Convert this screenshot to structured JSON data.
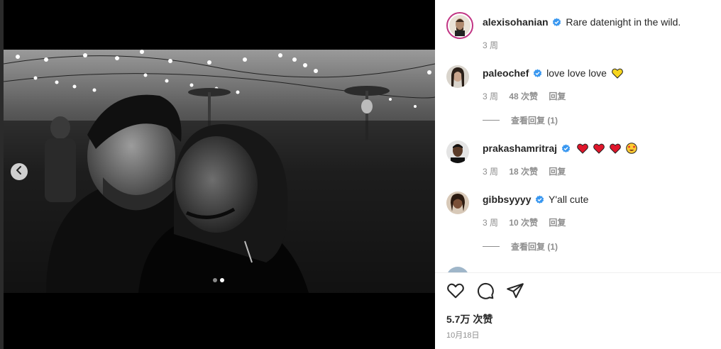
{
  "post": {
    "author": "alexisohanian",
    "caption": "Rare datenight in the wild.",
    "time": "3 周",
    "likes": "5.7万 次赞",
    "date": "10月18日"
  },
  "comments": [
    {
      "user": "paleochef",
      "text": "love love love",
      "emoji": "yellow-heart",
      "time": "3 周",
      "likes": "48 次赞",
      "reply": "回复",
      "view_replies": "查看回复 (1)"
    },
    {
      "user": "prakashamritraj",
      "text": "",
      "emoji": "hearts-and-star-eyes",
      "time": "3 周",
      "likes": "18 次赞",
      "reply": "回复"
    },
    {
      "user": "gibbsyyyy",
      "text": "Y'all cute",
      "time": "3 周",
      "likes": "10 次赞",
      "reply": "回复",
      "view_replies": "查看回复 (1)"
    }
  ],
  "carousel": {
    "current_slide": 2,
    "total_slides": 2
  },
  "icons": [
    "chevron-left-icon",
    "verified-badge-icon",
    "heart-icon",
    "comment-icon",
    "share-icon"
  ],
  "colors": {
    "verified": "#3897f0",
    "text": "#262626",
    "muted": "#8e8e8e",
    "panel": "#ffffff",
    "media_bg": "#000000"
  }
}
